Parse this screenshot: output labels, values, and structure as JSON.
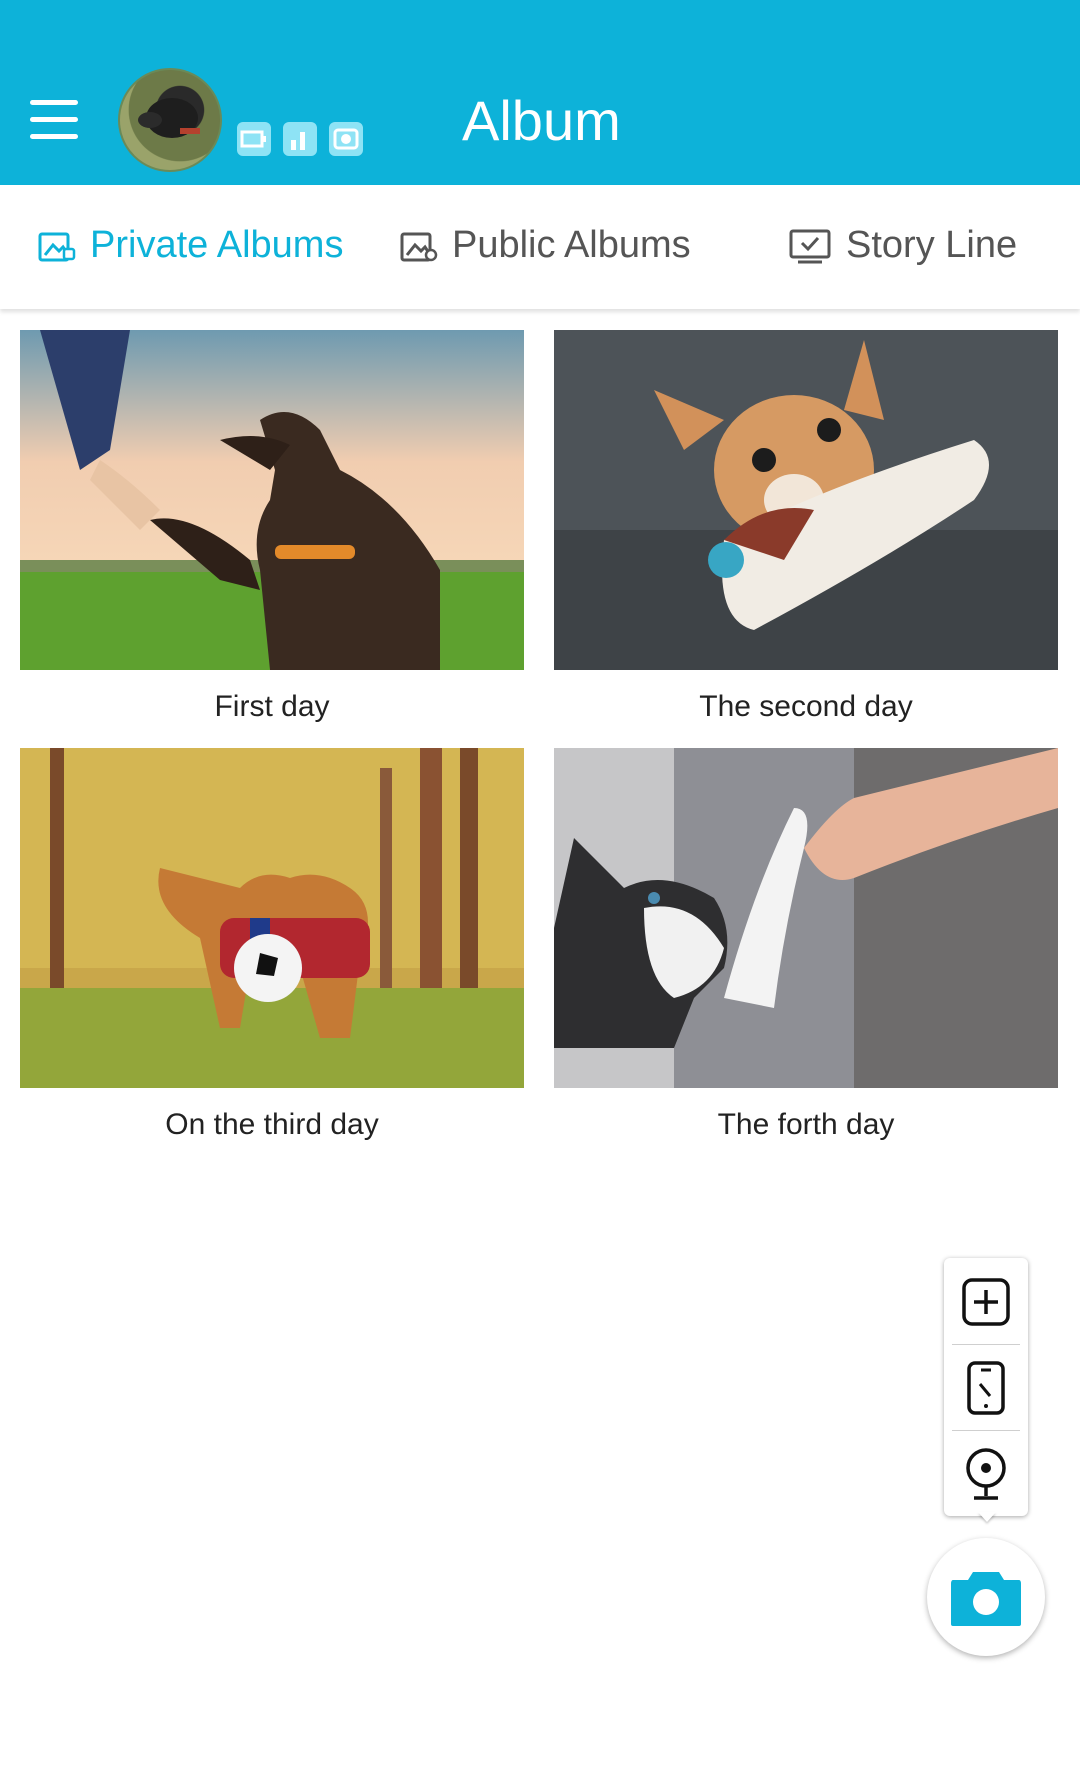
{
  "header": {
    "title": "Album",
    "background_color": "#0db2d9",
    "menu_icon": "hamburger-icon",
    "avatar": "dog-avatar",
    "status_icons": [
      "battery-icon",
      "signal-icon",
      "camera-small-icon"
    ]
  },
  "tabs": [
    {
      "label": "Private Albums",
      "icon": "private-album-icon",
      "active": true
    },
    {
      "label": "Public Albums",
      "icon": "public-album-icon",
      "active": false
    },
    {
      "label": "Story Line",
      "icon": "story-line-icon",
      "active": false
    }
  ],
  "albums": [
    {
      "caption": "First day",
      "image": "dog-shaking-hand-photo"
    },
    {
      "caption": "The second day",
      "image": "chihuahua-slipper-photo"
    },
    {
      "caption": "On the third day",
      "image": "dogs-soccer-ball-photo"
    },
    {
      "caption": "The forth day",
      "image": "husky-high-five-photo"
    }
  ],
  "floating_menu": {
    "items": [
      "add-icon",
      "phone-icon",
      "webcam-icon"
    ],
    "main_button": "camera-icon",
    "accent_color": "#0db2d9"
  }
}
